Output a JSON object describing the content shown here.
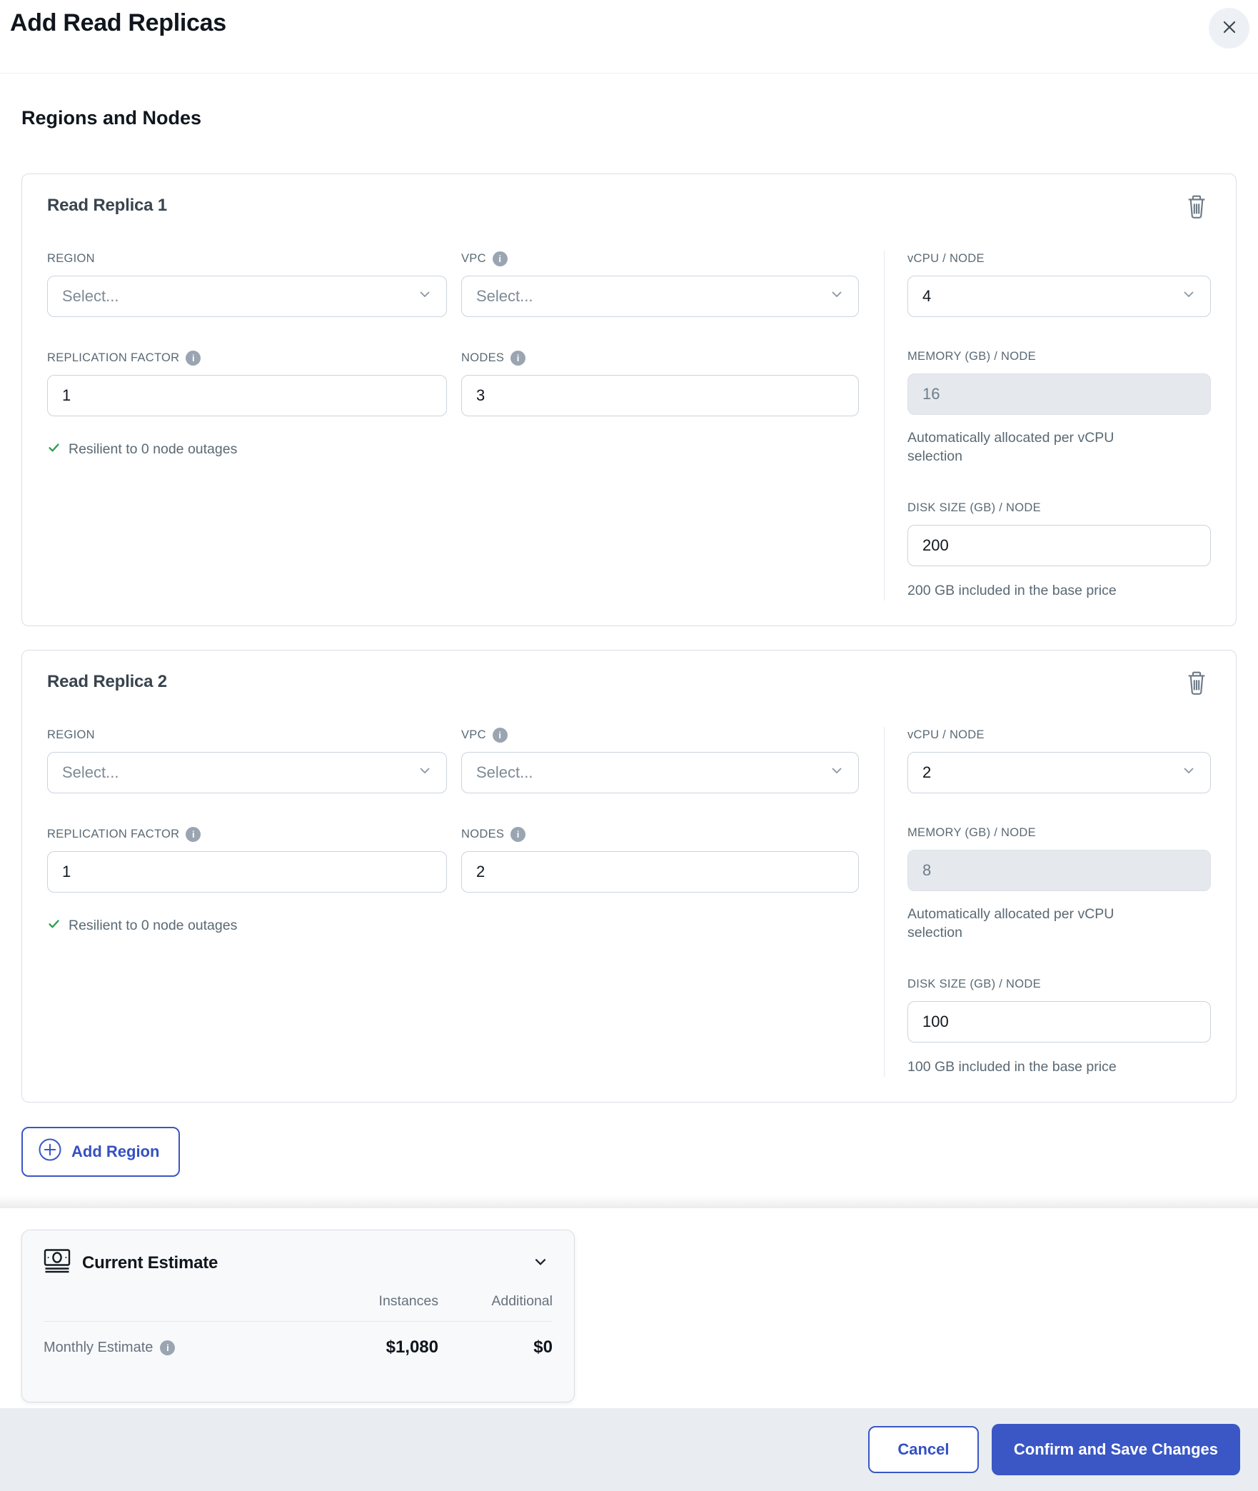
{
  "dialog": {
    "title": "Add Read Replicas"
  },
  "section": {
    "title": "Regions and Nodes"
  },
  "glyphs": {
    "info": "i"
  },
  "field_labels": {
    "region": "REGION",
    "vpc": "VPC",
    "vcpu_node": "vCPU / NODE",
    "replication_factor": "REPLICATION FACTOR",
    "nodes": "NODES",
    "memory_node": "MEMORY (GB) / NODE",
    "disk_node": "DISK SIZE (GB) / NODE",
    "memory_helper": "Automatically allocated per vCPU selection"
  },
  "replicas": [
    {
      "title": "Read Replica 1",
      "region_placeholder": "Select...",
      "vpc_placeholder": "Select...",
      "vcpu": "4",
      "replication_factor": "1",
      "nodes": "3",
      "memory": "16",
      "disk": "200",
      "resilience": "Resilient to 0 node outages",
      "disk_helper": "200 GB included in the base price"
    },
    {
      "title": "Read Replica 2",
      "region_placeholder": "Select...",
      "vpc_placeholder": "Select...",
      "vcpu": "2",
      "replication_factor": "1",
      "nodes": "2",
      "memory": "8",
      "disk": "100",
      "resilience": "Resilient to 0 node outages",
      "disk_helper": "100 GB included in the base price"
    }
  ],
  "actions": {
    "add_region": "Add Region",
    "cancel": "Cancel",
    "confirm": "Confirm and Save Changes"
  },
  "estimate": {
    "title": "Current Estimate",
    "columns": {
      "instances": "Instances",
      "additional": "Additional"
    },
    "monthly_label": "Monthly Estimate",
    "monthly_instances": "$1,080",
    "monthly_additional": "$0"
  },
  "colors": {
    "accent_blue": "#3A57C5",
    "success_green": "#2F9E50",
    "footer_bg": "#E9EDF2",
    "label_gray": "#5A6974",
    "border_gray": "#CCD4DD"
  }
}
